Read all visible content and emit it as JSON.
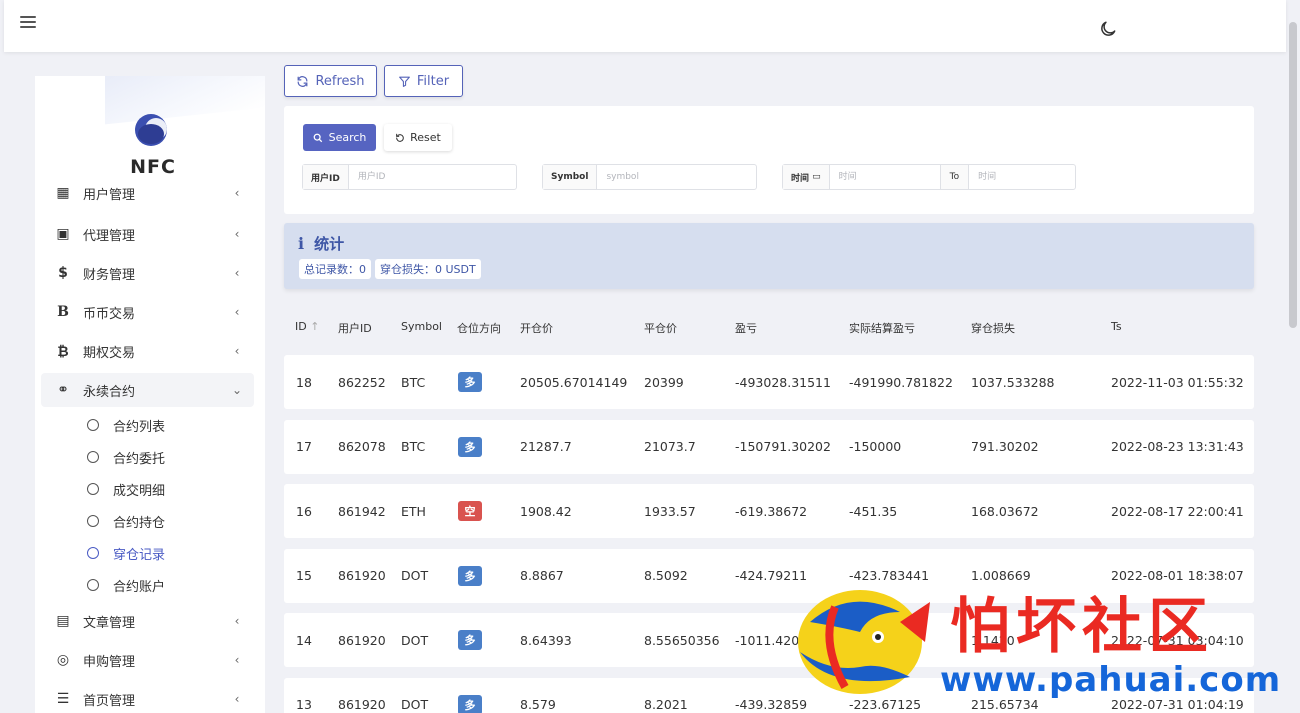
{
  "header": {
    "menu_icon": "hamburger-icon",
    "theme_icon": "moon-icon"
  },
  "brand": {
    "name": "NFC"
  },
  "sidebar": {
    "items": [
      {
        "label": "用户管理",
        "icon": "users-icon"
      },
      {
        "label": "代理管理",
        "icon": "id-card-icon"
      },
      {
        "label": "财务管理",
        "icon": "dollar-icon"
      },
      {
        "label": "币币交易",
        "icon": "b-icon"
      },
      {
        "label": "期权交易",
        "icon": "bitcoin-icon"
      },
      {
        "label": "永续合约",
        "icon": "link-icon"
      },
      {
        "label": "文章管理",
        "icon": "newspaper-icon"
      },
      {
        "label": "申购管理",
        "icon": "life-ring-icon"
      },
      {
        "label": "首页管理",
        "icon": "list-icon"
      }
    ],
    "submenu": [
      {
        "label": "合约列表"
      },
      {
        "label": "合约委托"
      },
      {
        "label": "成交明细"
      },
      {
        "label": "合约持仓"
      },
      {
        "label": "穿仓记录",
        "current": true
      },
      {
        "label": "合约账户"
      }
    ]
  },
  "toolbar": {
    "refresh_label": "Refresh",
    "filter_label": "Filter"
  },
  "filter": {
    "search_label": "Search",
    "reset_label": "Reset",
    "user_id_label": "用户ID",
    "user_id_placeholder": "用户ID",
    "symbol_label": "Symbol",
    "symbol_placeholder": "symbol",
    "time_label": "时间",
    "time_from_placeholder": "时间",
    "to_label": "To",
    "time_to_placeholder": "时间"
  },
  "stats": {
    "title": "统计",
    "total_records": "总记录数：0",
    "liquidation_loss": "穿仓损失：0 USDT"
  },
  "table": {
    "columns": [
      "ID",
      "用户ID",
      "Symbol",
      "仓位方向",
      "开仓价",
      "平仓价",
      "盈亏",
      "实际结算盈亏",
      "穿仓损失",
      "Ts"
    ],
    "rows": [
      {
        "id": "18",
        "user_id": "862252",
        "symbol": "BTC",
        "direction": "多",
        "open": "20505.67014149",
        "close": "20399",
        "pnl": "-493028.31511",
        "actual_pnl": "-491990.781822",
        "loss": "1037.533288",
        "ts": "2022-11-03 01:55:32"
      },
      {
        "id": "17",
        "user_id": "862078",
        "symbol": "BTC",
        "direction": "多",
        "open": "21287.7",
        "close": "21073.7",
        "pnl": "-150791.30202",
        "actual_pnl": "-150000",
        "loss": "791.30202",
        "ts": "2022-08-23 13:31:43"
      },
      {
        "id": "16",
        "user_id": "861942",
        "symbol": "ETH",
        "direction": "空",
        "open": "1908.42",
        "close": "1933.57",
        "pnl": "-619.38672",
        "actual_pnl": "-451.35",
        "loss": "168.03672",
        "ts": "2022-08-17 22:00:41"
      },
      {
        "id": "15",
        "user_id": "861920",
        "symbol": "DOT",
        "direction": "多",
        "open": "8.8867",
        "close": "8.5092",
        "pnl": "-424.79211",
        "actual_pnl": "-423.783441",
        "loss": "1.008669",
        "ts": "2022-08-01 18:38:07"
      },
      {
        "id": "14",
        "user_id": "861920",
        "symbol": "DOT",
        "direction": "多",
        "open": "8.64393",
        "close": "8.55650356",
        "pnl": "-1011.4204",
        "actual_pnl": "-1",
        "loss": "1.1420",
        "ts": "2022-07-31 03:04:10"
      },
      {
        "id": "13",
        "user_id": "861920",
        "symbol": "DOT",
        "direction": "多",
        "open": "8.579",
        "close": "8.2021",
        "pnl": "-439.32859",
        "actual_pnl": "-223.67125",
        "loss": "215.65734",
        "ts": "2022-07-31 01:04:19"
      }
    ]
  },
  "watermark": {
    "text": "怕坏社区",
    "url": "www.pahuai.com"
  }
}
